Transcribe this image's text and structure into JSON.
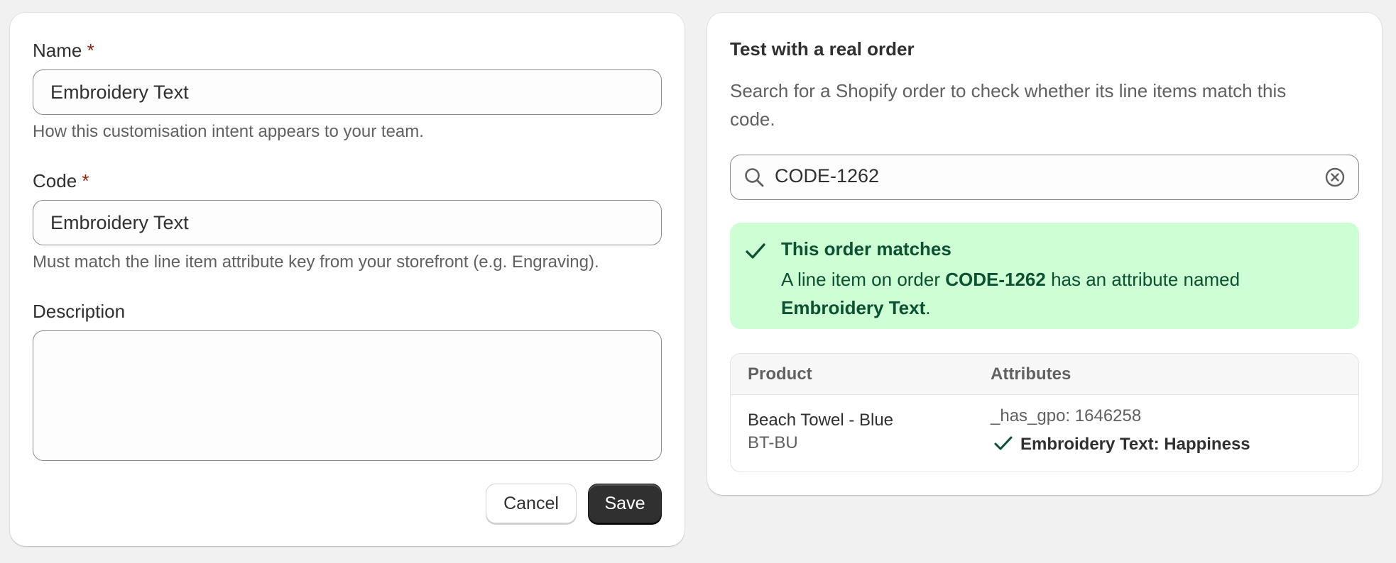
{
  "form": {
    "name_label": "Name",
    "name_value": "Embroidery Text",
    "name_help": "How this customisation intent appears to your team.",
    "code_label": "Code",
    "code_value": "Embroidery Text",
    "code_help": "Must match the line item attribute key from your storefront (e.g. Engraving).",
    "description_label": "Description",
    "description_value": "",
    "required_marker": "*",
    "cancel_label": "Cancel",
    "save_label": "Save"
  },
  "test": {
    "title": "Test with a real order",
    "subtitle": "Search for a Shopify order to check whether its line items match this code.",
    "search_value": "CODE-1262",
    "banner": {
      "title": "This order matches",
      "body_prefix": "A line item on order ",
      "order": "CODE-1262",
      "body_mid": " has an attribute named ",
      "attribute": "Embroidery Text",
      "body_suffix": "."
    },
    "table": {
      "headers": [
        "Product",
        "Attributes"
      ],
      "rows": [
        {
          "product": "Beach Towel - Blue",
          "sku": "BT-BU",
          "attributes": [
            {
              "text": "_has_gpo: 1646258",
              "matched": false
            },
            {
              "text": "Embroidery Text: Happiness",
              "matched": true
            }
          ]
        }
      ]
    }
  },
  "colors": {
    "page_bg": "#f1f1f1",
    "required": "#8e1f0b",
    "success_bg": "#cdfed4",
    "success_text": "#0c5132",
    "check_icon": "#0c5132",
    "primary_button": "#303030"
  }
}
